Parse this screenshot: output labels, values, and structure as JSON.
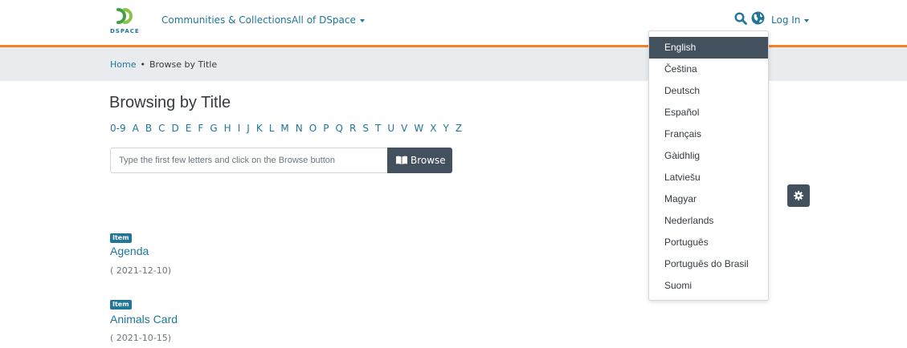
{
  "header": {
    "logo_text": "DSPACE",
    "nav": [
      {
        "label": "Communities & Collections"
      },
      {
        "label": "All of DSpace"
      }
    ],
    "login_label": "Log In"
  },
  "breadcrumb": {
    "home": "Home",
    "separator": "•",
    "current": "Browse by Title"
  },
  "page_title": "Browsing by Title",
  "alphabet": [
    "0-9",
    "A",
    "B",
    "C",
    "D",
    "E",
    "F",
    "G",
    "H",
    "I",
    "J",
    "K",
    "L",
    "M",
    "N",
    "O",
    "P",
    "Q",
    "R",
    "S",
    "T",
    "U",
    "V",
    "W",
    "X",
    "Y",
    "Z"
  ],
  "browse": {
    "placeholder": "Type the first few letters and click on the Browse button",
    "button_label": "Browse"
  },
  "items": [
    {
      "badge": "Item",
      "title": "Agenda",
      "date": "( 2021-12-10)"
    },
    {
      "badge": "Item",
      "title": "Animals Card",
      "date": "( 2021-10-15)"
    }
  ],
  "language_menu": {
    "selected": "English",
    "options": [
      "English",
      "Čeština",
      "Deutsch",
      "Español",
      "Français",
      "Gàidhlig",
      "Latviešu",
      "Magyar",
      "Nederlands",
      "Português",
      "Português do Brasil",
      "Suomi"
    ]
  },
  "colors": {
    "link": "#207698",
    "accent": "#f48120",
    "dark_button": "#43515f",
    "breadcrumb_bg": "#e9ecef"
  },
  "icons": {
    "search": "search-icon",
    "globe": "globe-icon",
    "book": "book-icon",
    "gear": "gear-icon"
  }
}
